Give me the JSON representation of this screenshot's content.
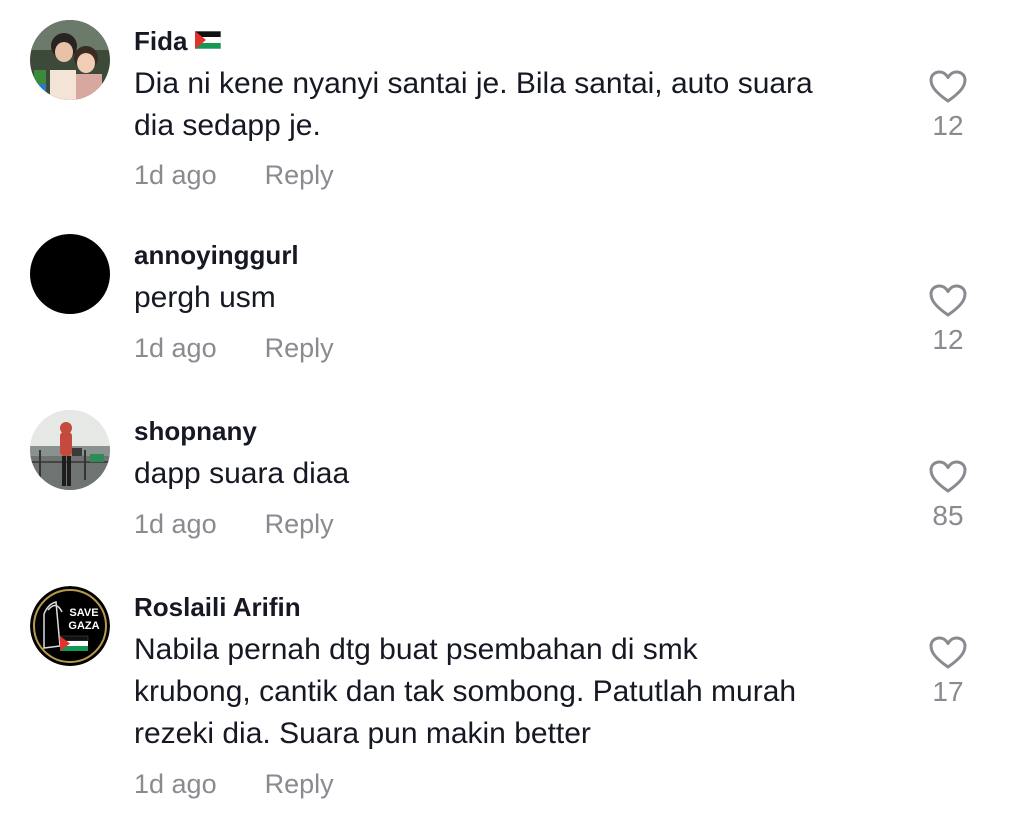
{
  "comments": [
    {
      "username": "Fida",
      "text_lines": [
        "Dia ni kene nyanyi santai je. Bila santai, auto suara",
        "dia sedapp je."
      ],
      "time": "1d ago",
      "reply_label": "Reply",
      "likes": "12",
      "avatar": "avatar-photo-children"
    },
    {
      "username": "annoyinggurl",
      "text_lines": [
        "pergh usm"
      ],
      "time": "1d ago",
      "reply_label": "Reply",
      "likes": "12",
      "avatar": "avatar-black-circle"
    },
    {
      "username": "shopnany",
      "text_lines": [
        "dapp suara diaa"
      ],
      "time": "1d ago",
      "reply_label": "Reply",
      "likes": "85",
      "avatar": "avatar-photo-person"
    },
    {
      "username": "Roslaili Arifin",
      "text_lines": [
        "Nabila pernah dtg buat psembahan di smk",
        "krubong, cantik dan tak sombong. Patutlah murah",
        "rezeki dia. Suara pun makin better"
      ],
      "time": "1d ago",
      "reply_label": "Reply",
      "likes": "17",
      "avatar": "avatar-save-gaza-badge",
      "avatar_text": [
        "SAVE",
        "GAZA"
      ]
    }
  ],
  "icons": {
    "like": "heart-outline-icon",
    "flag": "palestine-flag-icon"
  },
  "colors": {
    "text_primary": "#161823",
    "text_secondary": "#8a8b91",
    "heart_stroke": "#8a8b91"
  }
}
